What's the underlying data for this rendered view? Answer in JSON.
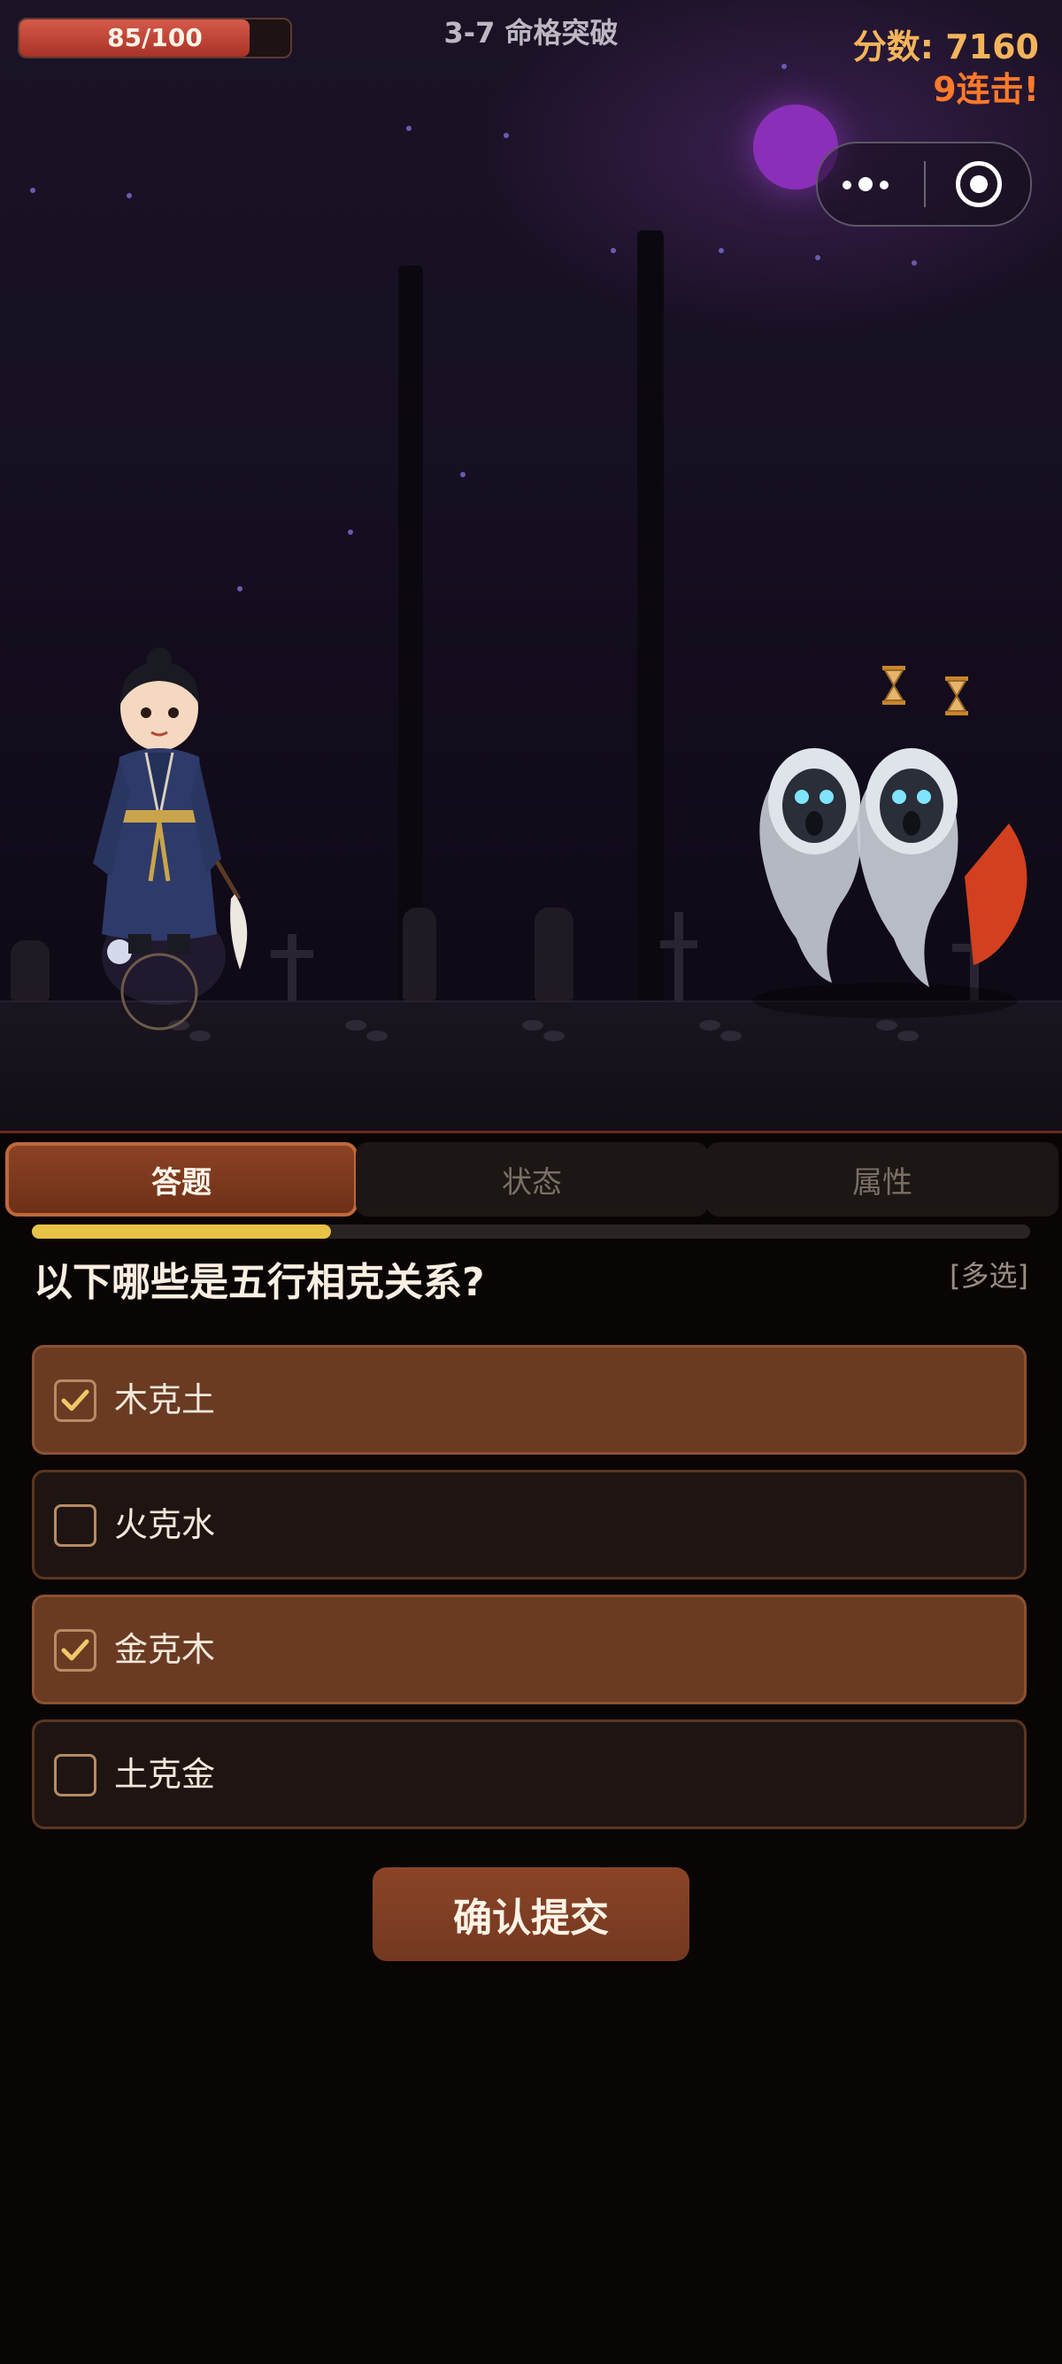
{
  "hud": {
    "hp_text": "85/100",
    "hp_fraction": 0.85,
    "level_title": "3-7 命格突破",
    "score_text": "分数: 7160",
    "combo_text": "9连击!"
  },
  "tabs": [
    {
      "label": "答题",
      "active": true
    },
    {
      "label": "状态",
      "active": false
    },
    {
      "label": "属性",
      "active": false
    }
  ],
  "quiz": {
    "progress_fraction": 0.3,
    "question": "以下哪些是五行相克关系?",
    "type_tag": "[多选]",
    "options": [
      {
        "label": "木克土",
        "checked": true
      },
      {
        "label": "火克水",
        "checked": false
      },
      {
        "label": "金克木",
        "checked": true
      },
      {
        "label": "土克金",
        "checked": false
      }
    ],
    "submit_label": "确认提交"
  },
  "colors": {
    "accent": "#e8c147",
    "score": "#f3b45a",
    "combo": "#ff7a2a",
    "hp": "#c8453a"
  }
}
